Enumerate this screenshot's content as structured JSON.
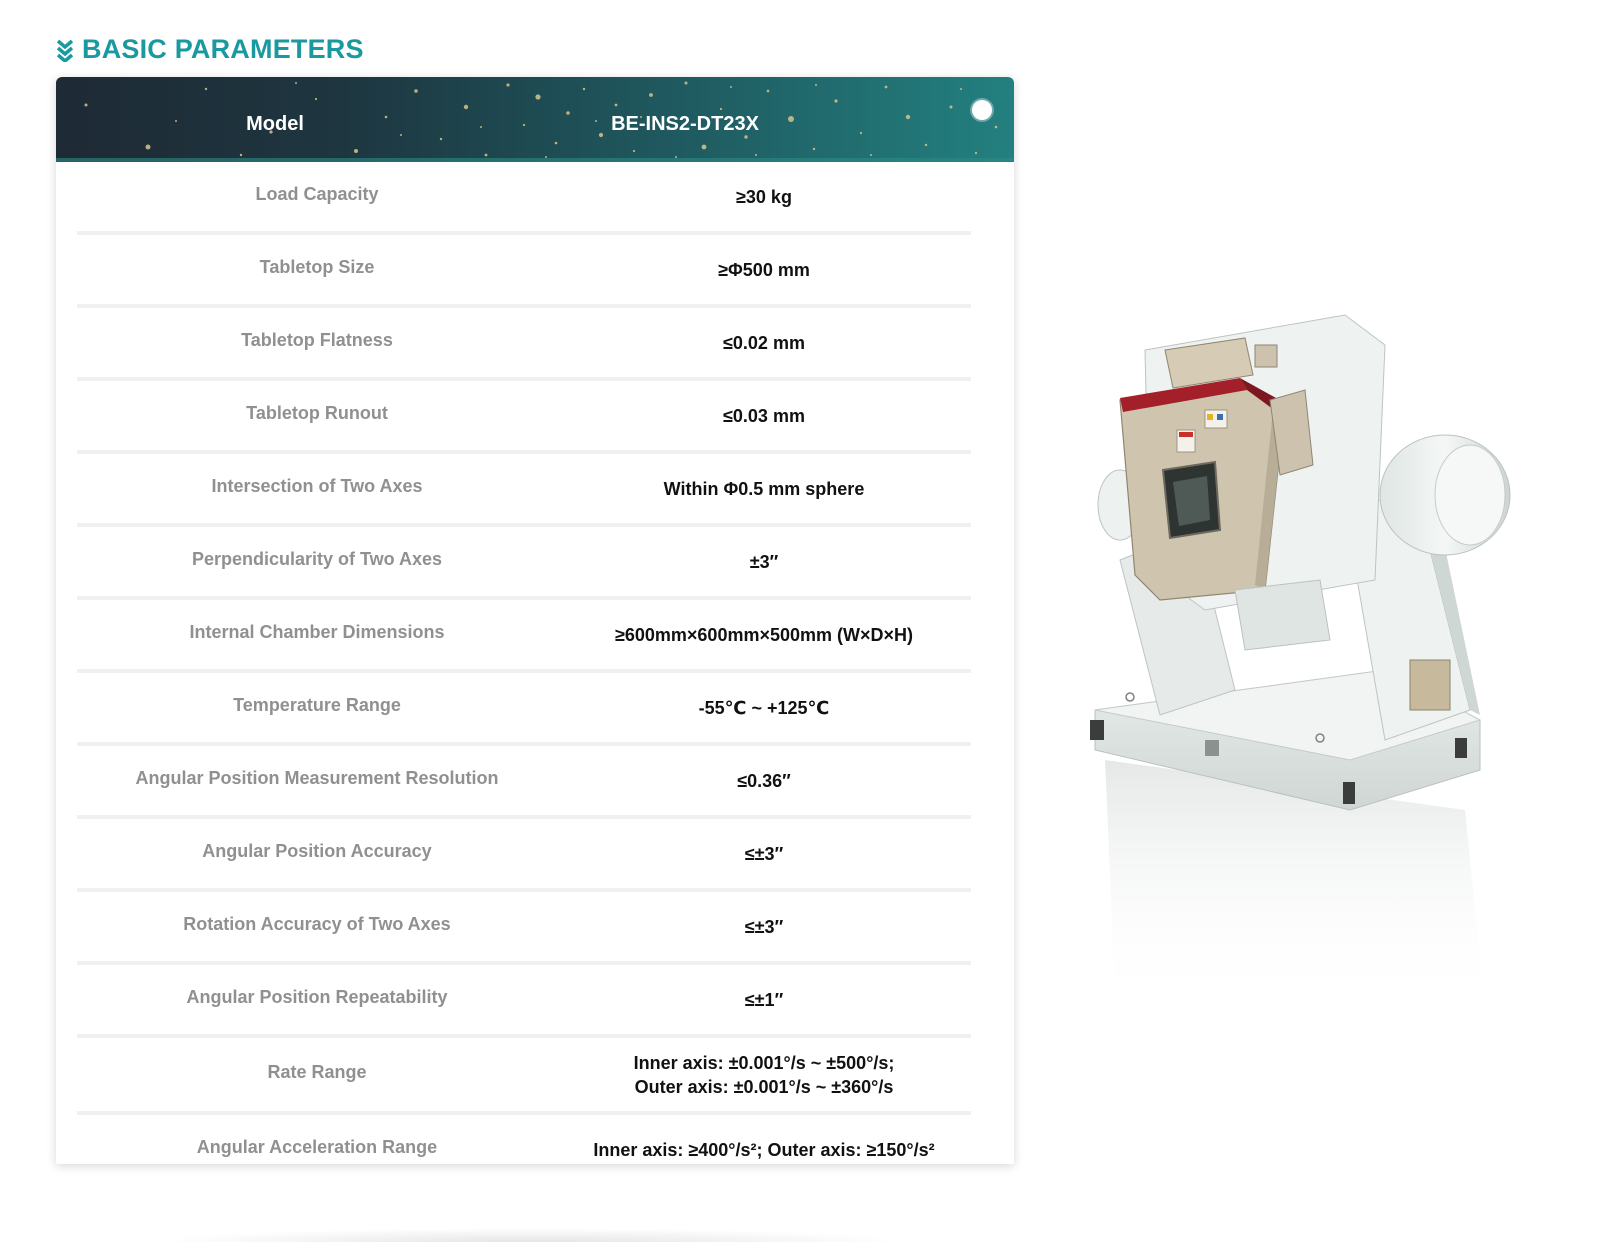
{
  "section": {
    "title": "BASIC PARAMETERS",
    "icon": "double-chevron-down-icon",
    "accent_color": "#1a9aa0"
  },
  "table": {
    "header": {
      "label": "Model",
      "value": "BE-INS2-DT23X"
    },
    "rows": [
      {
        "label": "Load Capacity",
        "value": [
          "≥30 kg"
        ]
      },
      {
        "label": "Tabletop Size",
        "value": [
          "≥Φ500 mm"
        ]
      },
      {
        "label": "Tabletop Flatness",
        "value": [
          "≤0.02 mm"
        ]
      },
      {
        "label": "Tabletop Runout",
        "value": [
          "≤0.03 mm"
        ]
      },
      {
        "label": "Intersection of Two Axes",
        "value": [
          "Within Φ0.5 mm sphere"
        ]
      },
      {
        "label": "Perpendicularity of Two Axes",
        "value": [
          "±3″"
        ]
      },
      {
        "label": "Internal Chamber Dimensions",
        "value": [
          "≥600mm×600mm×500mm (W×D×H)"
        ]
      },
      {
        "label": "Temperature Range",
        "value": [
          "-55℃ ~ +125℃"
        ]
      },
      {
        "label": "Angular Position Measurement Resolution",
        "value": [
          "≤0.36″"
        ]
      },
      {
        "label": "Angular Position Accuracy",
        "value": [
          "≤±3″"
        ]
      },
      {
        "label": "Rotation Accuracy of Two Axes",
        "value": [
          "≤±3″"
        ]
      },
      {
        "label": "Angular Position Repeatability",
        "value": [
          "≤±1″"
        ]
      },
      {
        "label": "Rate Range",
        "value": [
          "Inner axis: ±0.001°/s ~ ±500°/s;",
          "Outer axis: ±0.001°/s ~ ±360°/s"
        ]
      },
      {
        "label": "Angular Acceleration Range",
        "value": [
          "Inner axis: ≥400°/s²; Outer axis: ≥150°/s²"
        ]
      }
    ]
  },
  "product_image": {
    "subject": "two-axis-turntable-with-temperature-chamber"
  }
}
